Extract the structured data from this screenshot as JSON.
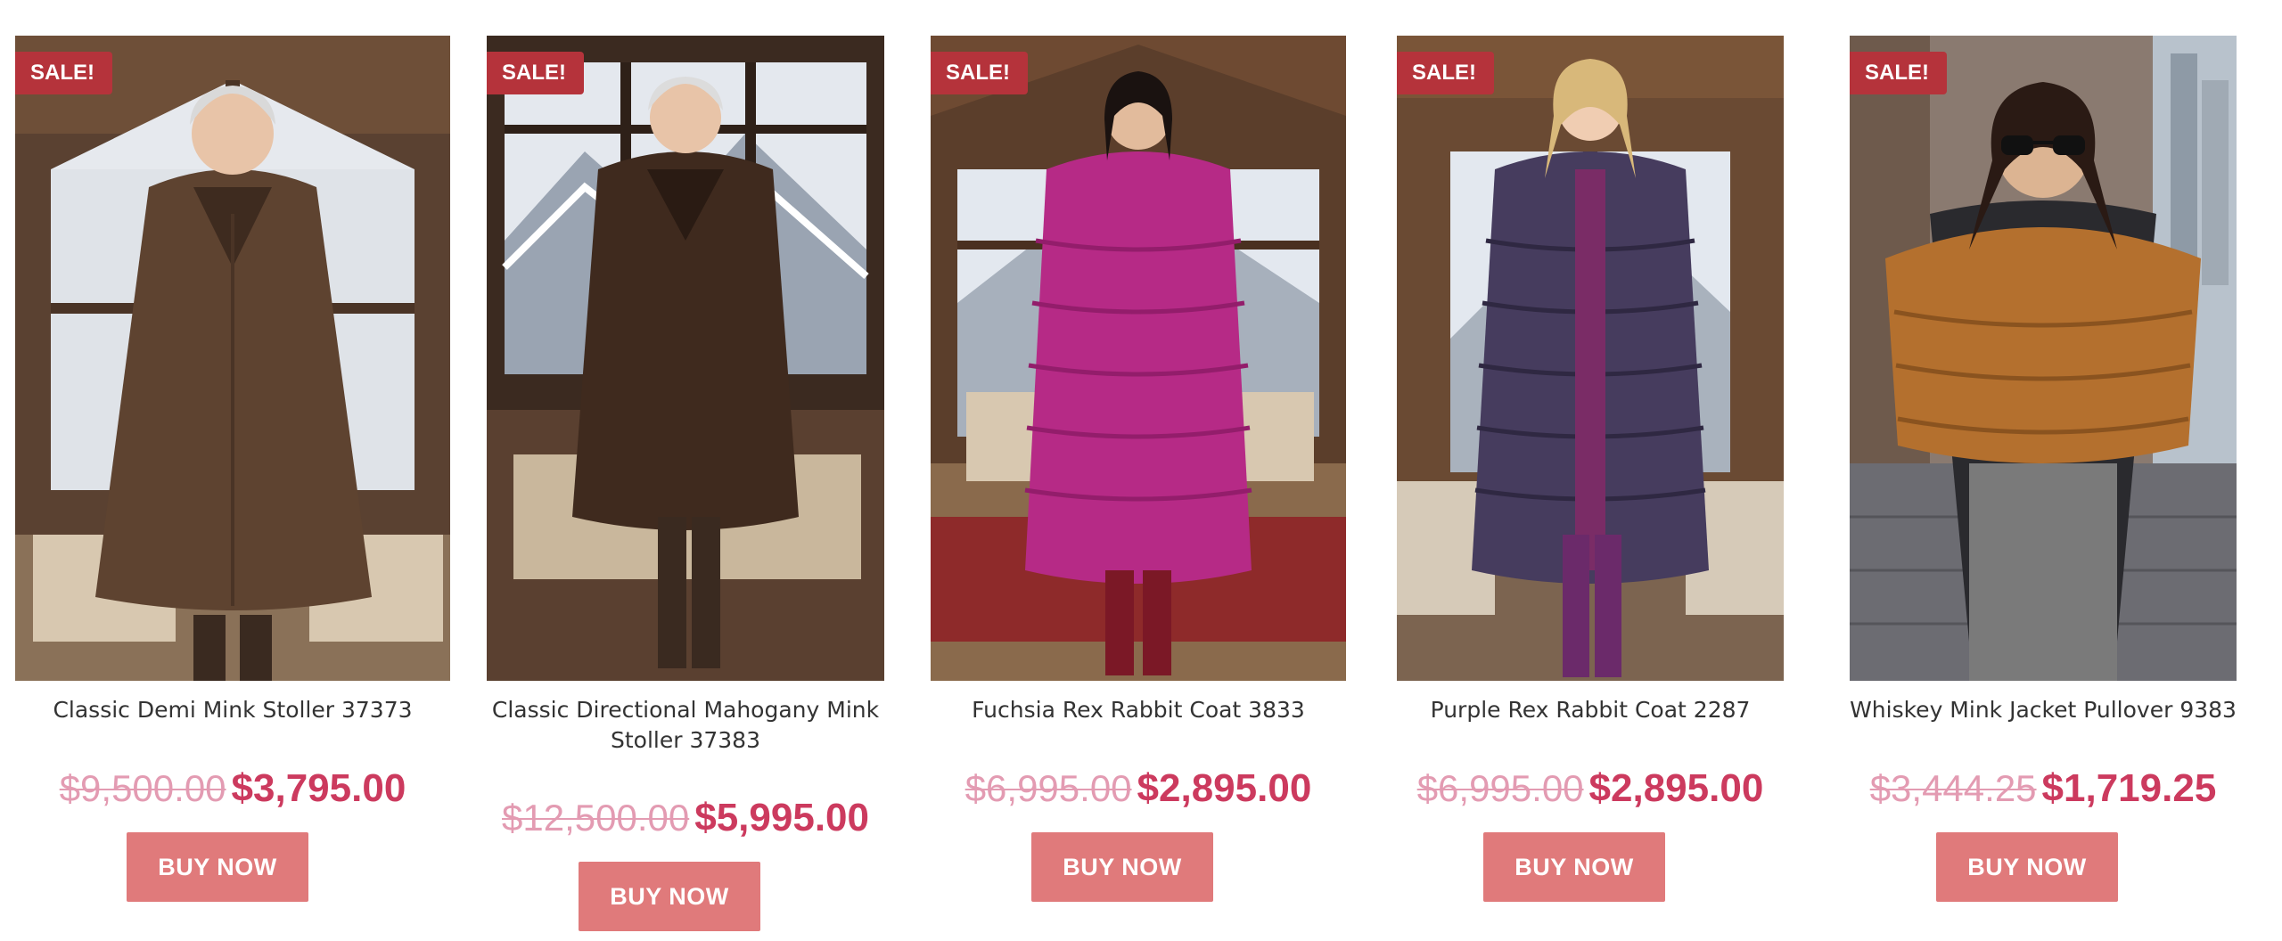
{
  "products": [
    {
      "sale_badge": "SALE!",
      "title": "Classic Demi Mink Stoller 37373",
      "old_price": "$9,500.00",
      "sale_price": "$3,795.00",
      "button_label": "BUY NOW"
    },
    {
      "sale_badge": "SALE!",
      "title": "Classic Directional Mahogany Mink Stoller 37383",
      "old_price": "$12,500.00",
      "sale_price": "$5,995.00",
      "button_label": "BUY NOW"
    },
    {
      "sale_badge": "SALE!",
      "title": "Fuchsia Rex Rabbit Coat 3833",
      "old_price": "$6,995.00",
      "sale_price": "$2,895.00",
      "button_label": "BUY NOW"
    },
    {
      "sale_badge": "SALE!",
      "title": "Purple Rex Rabbit Coat 2287",
      "old_price": "$6,995.00",
      "sale_price": "$2,895.00",
      "button_label": "BUY NOW"
    },
    {
      "sale_badge": "SALE!",
      "title": "Whiskey Mink Jacket Pullover 9383",
      "old_price": "$3,444.25",
      "sale_price": "$1,719.25",
      "button_label": "BUY NOW"
    }
  ],
  "colors": {
    "sale_badge": "#b5333b",
    "old_price": "#e39bb2",
    "sale_price": "#cc3a5e",
    "button": "#e07a7b",
    "coat_1": "#5e4330",
    "coat_2": "#3f2a1e",
    "coat_3": "#b62a86",
    "coat_4": "#463c5e",
    "coat_5": "#b4702e"
  }
}
